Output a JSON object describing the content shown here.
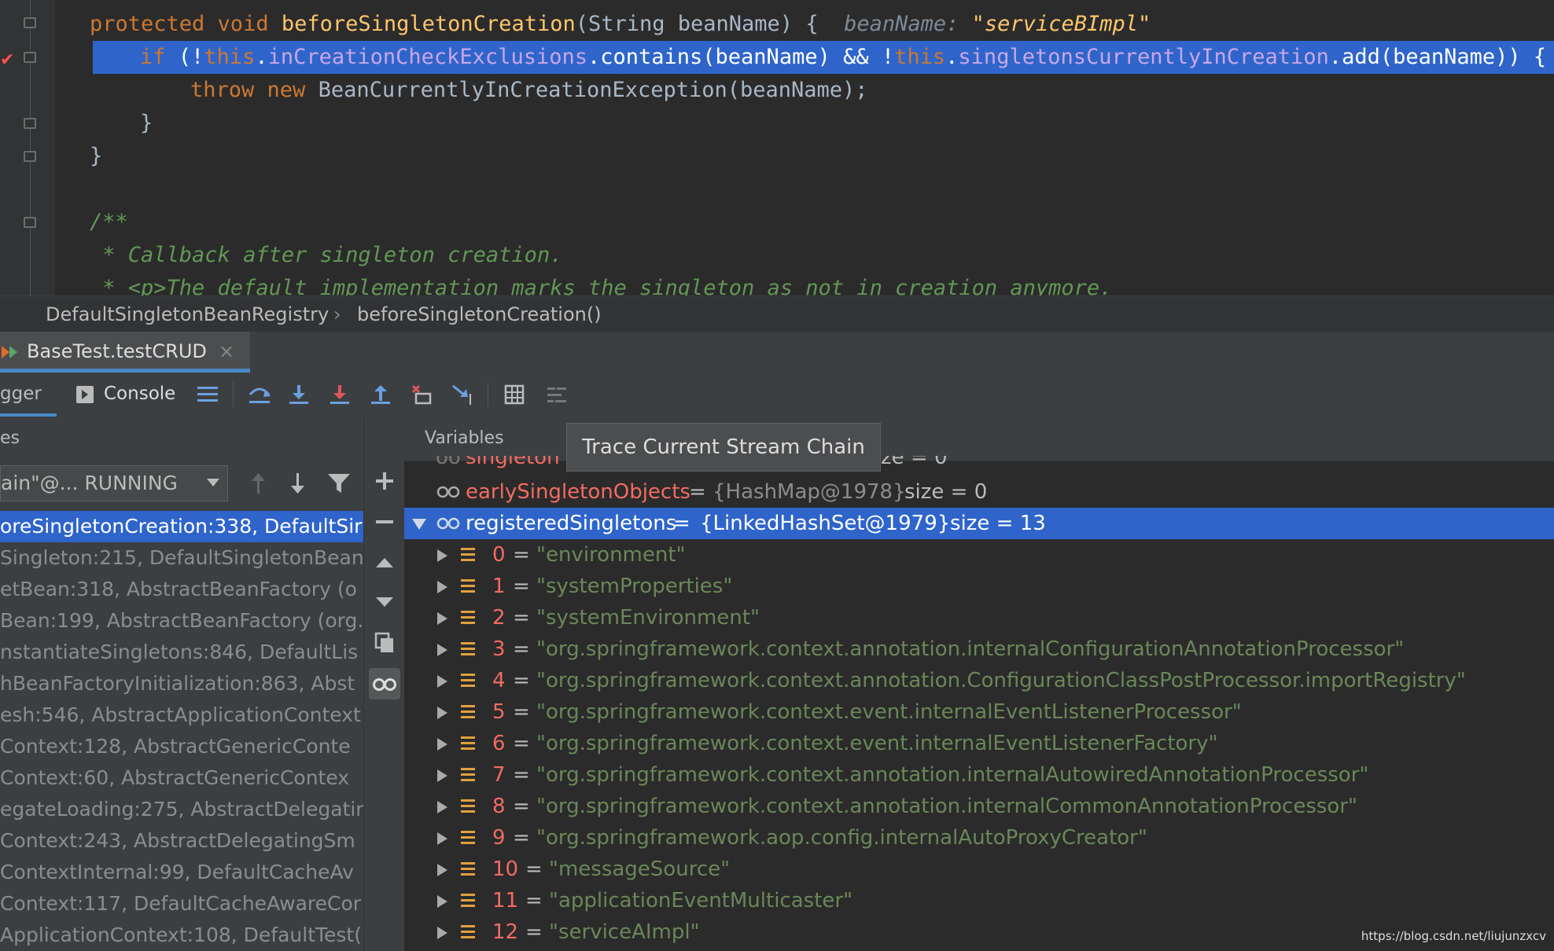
{
  "editor": {
    "line1": {
      "prefix": "protected void ",
      "method": "beforeSingletonCreation",
      "params": "(String beanName) {",
      "hint_name": "beanName:",
      "hint_value": "\"serviceBImpl\""
    },
    "line2": {
      "if_kw": "if",
      "open": " (!",
      "this1": "this",
      ".f1": ".",
      "field1": "inCreationCheckExclusions",
      "mid": ".contains(beanName) && !",
      "this2": "this",
      "field2": "singletonsCurrentlyInCreation",
      "end": ".add(beanName)) {"
    },
    "line3": {
      "throw_kw": "throw",
      "new_kw": "new",
      "rest": " BeanCurrentlyInCreationException(beanName);"
    },
    "line4": "}",
    "line5": "}",
    "line6": "/**",
    "line7": " * Callback after singleton creation.",
    "line8": " * <p>The default implementation marks the singleton as not in creation anymore."
  },
  "breadcrumb": {
    "class": "DefaultSingletonBeanRegistry",
    "separator": "›",
    "method": "beforeSingletonCreation()"
  },
  "run_tab": {
    "label": "BaseTest.testCRUD",
    "close": "×"
  },
  "toolbar": {
    "debugger_label": "gger",
    "console_label": "Console"
  },
  "frames": {
    "header": "es",
    "thread": "ain\"@... RUNNING",
    "rows": [
      "oreSingletonCreation:338, DefaultSir",
      "Singleton:215, DefaultSingletonBean",
      "etBean:318, AbstractBeanFactory (o",
      "Bean:199, AbstractBeanFactory (org.",
      "nstantiateSingletons:846, DefaultLis",
      "hBeanFactoryInitialization:863, Abst",
      "esh:546, AbstractApplicationContext",
      "Context:128, AbstractGenericConte",
      "Context:60, AbstractGenericContex",
      "egateLoading:275, AbstractDelegatin",
      "Context:243, AbstractDelegatingSm",
      "ContextInternal:99, DefaultCacheAv",
      "Context:117, DefaultCacheAwareCor",
      "ApplicationContext:108, DefaultTest("
    ]
  },
  "variables": {
    "header": "Variables",
    "partial_top": "singleton",
    "partial_top_right": "ze = 0",
    "early": {
      "name": "earlySingletonObjects",
      "eq": " = ",
      "type": "{HashMap@1978}",
      "size": "size = 0"
    },
    "registered": {
      "name": "registeredSingletons",
      "eq": " = ",
      "type": "{LinkedHashSet@1979}",
      "size": "size = 13"
    },
    "items": [
      {
        "idx": "0",
        "val": "\"environment\""
      },
      {
        "idx": "1",
        "val": "\"systemProperties\""
      },
      {
        "idx": "2",
        "val": "\"systemEnvironment\""
      },
      {
        "idx": "3",
        "val": "\"org.springframework.context.annotation.internalConfigurationAnnotationProcessor\""
      },
      {
        "idx": "4",
        "val": "\"org.springframework.context.annotation.ConfigurationClassPostProcessor.importRegistry\""
      },
      {
        "idx": "5",
        "val": "\"org.springframework.context.event.internalEventListenerProcessor\""
      },
      {
        "idx": "6",
        "val": "\"org.springframework.context.event.internalEventListenerFactory\""
      },
      {
        "idx": "7",
        "val": "\"org.springframework.context.annotation.internalAutowiredAnnotationProcessor\""
      },
      {
        "idx": "8",
        "val": "\"org.springframework.context.annotation.internalCommonAnnotationProcessor\""
      },
      {
        "idx": "9",
        "val": "\"org.springframework.aop.config.internalAutoProxyCreator\""
      },
      {
        "idx": "10",
        "val": "\"messageSource\""
      },
      {
        "idx": "11",
        "val": "\"applicationEventMulticaster\""
      },
      {
        "idx": "12",
        "val": "\"serviceAImpl\""
      }
    ]
  },
  "tooltip": "Trace Current Stream Chain",
  "watermark": "https://blog.csdn.net/liujunzxcv",
  "colors": {
    "selection": "#2f65ca",
    "keyword": "#cc7832",
    "method": "#ffc66d",
    "field": "#9876aa",
    "string": "#6a8759",
    "index": "#f26b62"
  }
}
